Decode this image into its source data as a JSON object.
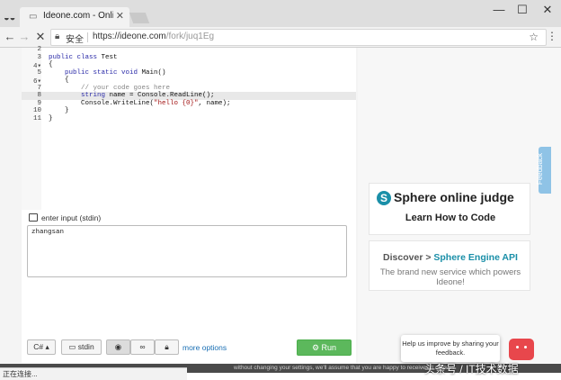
{
  "browser": {
    "tab_title": "Ideone.com - Online Co",
    "secure_label": "安全",
    "url_host": "https://ideone.com",
    "url_path": "/fork/juq1Eg",
    "status_text": "正在连接..."
  },
  "editor": {
    "lines": [
      {
        "num": "2",
        "fold": "",
        "text": ""
      },
      {
        "num": "3",
        "fold": "",
        "text": "public class Test"
      },
      {
        "num": "4",
        "fold": "▾",
        "text": "{"
      },
      {
        "num": "5",
        "fold": "",
        "text": "    public static void Main()"
      },
      {
        "num": "6",
        "fold": "▾",
        "text": "    {"
      },
      {
        "num": "7",
        "fold": "",
        "text": "        // your code goes here"
      },
      {
        "num": "8",
        "fold": "",
        "text": "        string name = Console.ReadLine();"
      },
      {
        "num": "9",
        "fold": "",
        "text": "        Console.WriteLine(\"hello {0}\", name);"
      },
      {
        "num": "10",
        "fold": "",
        "text": "    }"
      },
      {
        "num": "11",
        "fold": "",
        "text": "}"
      }
    ]
  },
  "stdin": {
    "label": "enter input (stdin)",
    "value": "zhangsan"
  },
  "controls": {
    "language": "C#",
    "stdin_button": "stdin",
    "more_options": "more options",
    "run": "Run"
  },
  "ads": {
    "sphere_title": "Sphere online judge",
    "sphere_subtitle": "Learn How to Code",
    "discover_prefix": "Discover >",
    "discover_highlight": "Sphere Engine API",
    "discover_desc": "The brand new service which powers Ideone!"
  },
  "feedback": {
    "tab_label": "Feedback",
    "popup_text": "Help us improve by sharing your feedback."
  },
  "cookie_text": "without changing your settings, we'll assume that you are happy to receive all cookies",
  "watermark": "头条号 / IT技术数据"
}
